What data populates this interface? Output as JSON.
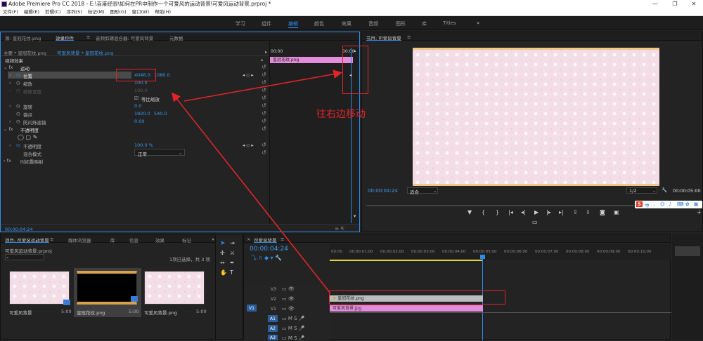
{
  "window": {
    "title": "Adobe Premiere Pro CC 2018 - E:\\百度经验\\如何在PR中制作一个可爱风的运动背景\\可爱风运动背景.prproj *",
    "minimize": "—",
    "restore": "❐",
    "close": "✕"
  },
  "menu": [
    "文件(F)",
    "编辑(E)",
    "剪辑(C)",
    "序列(S)",
    "标记(M)",
    "图形(G)",
    "窗口(W)",
    "帮助(H)"
  ],
  "workspaces": [
    {
      "label": "学习",
      "active": false
    },
    {
      "label": "组件",
      "active": false
    },
    {
      "label": "编辑",
      "active": true
    },
    {
      "label": "颜色",
      "active": false
    },
    {
      "label": "效果",
      "active": false
    },
    {
      "label": "音频",
      "active": false
    },
    {
      "label": "图形",
      "active": false
    },
    {
      "label": "库",
      "active": false
    },
    {
      "label": "Titles",
      "active": false
    },
    {
      "label": "»",
      "active": false
    }
  ],
  "effect_controls": {
    "tabs": [
      "源: 皇冠花纹.png",
      "效果控件",
      "音频剪辑混合器: 可爱风背景",
      "元数据"
    ],
    "source_line": "主要 * 皇冠花纹.png",
    "clip_line": "可爱风背景 * 皇冠花纹.png",
    "video_effects": "视频效果",
    "motion": "运动",
    "position_label": "位置",
    "position_x": "4046.0",
    "position_y": "1080.0",
    "scale_label": "缩放",
    "scale_value": "100.0",
    "scale_width_label": "缩放宽度",
    "scale_width_value": "100.0",
    "uniform_scale": "等比缩放",
    "rotation_label": "旋转",
    "rotation_value": "0.0",
    "anchor_label": "锚点",
    "anchor_x": "1920.0",
    "anchor_y": "540.0",
    "antiflicker_label": "防闪烁滤镜",
    "antiflicker_value": "0.00",
    "opacity_group": "不透明度",
    "opacity_label": "不透明度",
    "opacity_value": "100.0 %",
    "blend_label": "混合模式",
    "blend_value": "正常",
    "time_remap": "时间重映射",
    "mini_time": "00:00",
    "mini_time_end": "00:00",
    "mini_clip": "皇冠花纹.png",
    "timecode": "00:00:04:24"
  },
  "program": {
    "title": "节目: 可爱风背景",
    "timecode": "00:00:04:24",
    "fit": "适合",
    "quality": "1/2",
    "duration": "00:00:05:00"
  },
  "annotation": {
    "text": "往右边移动"
  },
  "project": {
    "tabs": [
      "项目: 可爱风运动背景",
      "媒体浏览器",
      "库",
      "信息",
      "效果",
      "标记"
    ],
    "file": "可爱风运动背景.prproj",
    "selection": "1项已选择，共 3 项",
    "items": [
      {
        "name": "可爱风背景",
        "duration": "5:00"
      },
      {
        "name": "皇冠花纹.png",
        "duration": "5:00"
      },
      {
        "name": "可爱风背景.png",
        "duration": "5:00"
      }
    ]
  },
  "timeline": {
    "title": "可爱风背景",
    "timecode": "00:00:04:24",
    "ruler": [
      "00:00",
      "00:00:01:00",
      "00:00:02:00",
      "00:00:03:00",
      "00:00:04:00",
      "00:00:05:00",
      "00:00:06:00",
      "00:00:07:00",
      "00:00:08:00",
      "00:00:09:00",
      "00:00:10:00"
    ],
    "video_tracks": [
      "V3",
      "V2",
      "V1"
    ],
    "audio_tracks": [
      "A1",
      "A2",
      "A3"
    ],
    "clip_v2": "皇冠花纹.png",
    "clip_v1": "可爱风背景.jpg"
  },
  "ime": {
    "label": "中"
  },
  "colors": {
    "accent": "#2d8ceb",
    "annotation": "#e0242a",
    "clip_pink": "#e48cdc",
    "clip_gray": "#bcbcbc"
  }
}
